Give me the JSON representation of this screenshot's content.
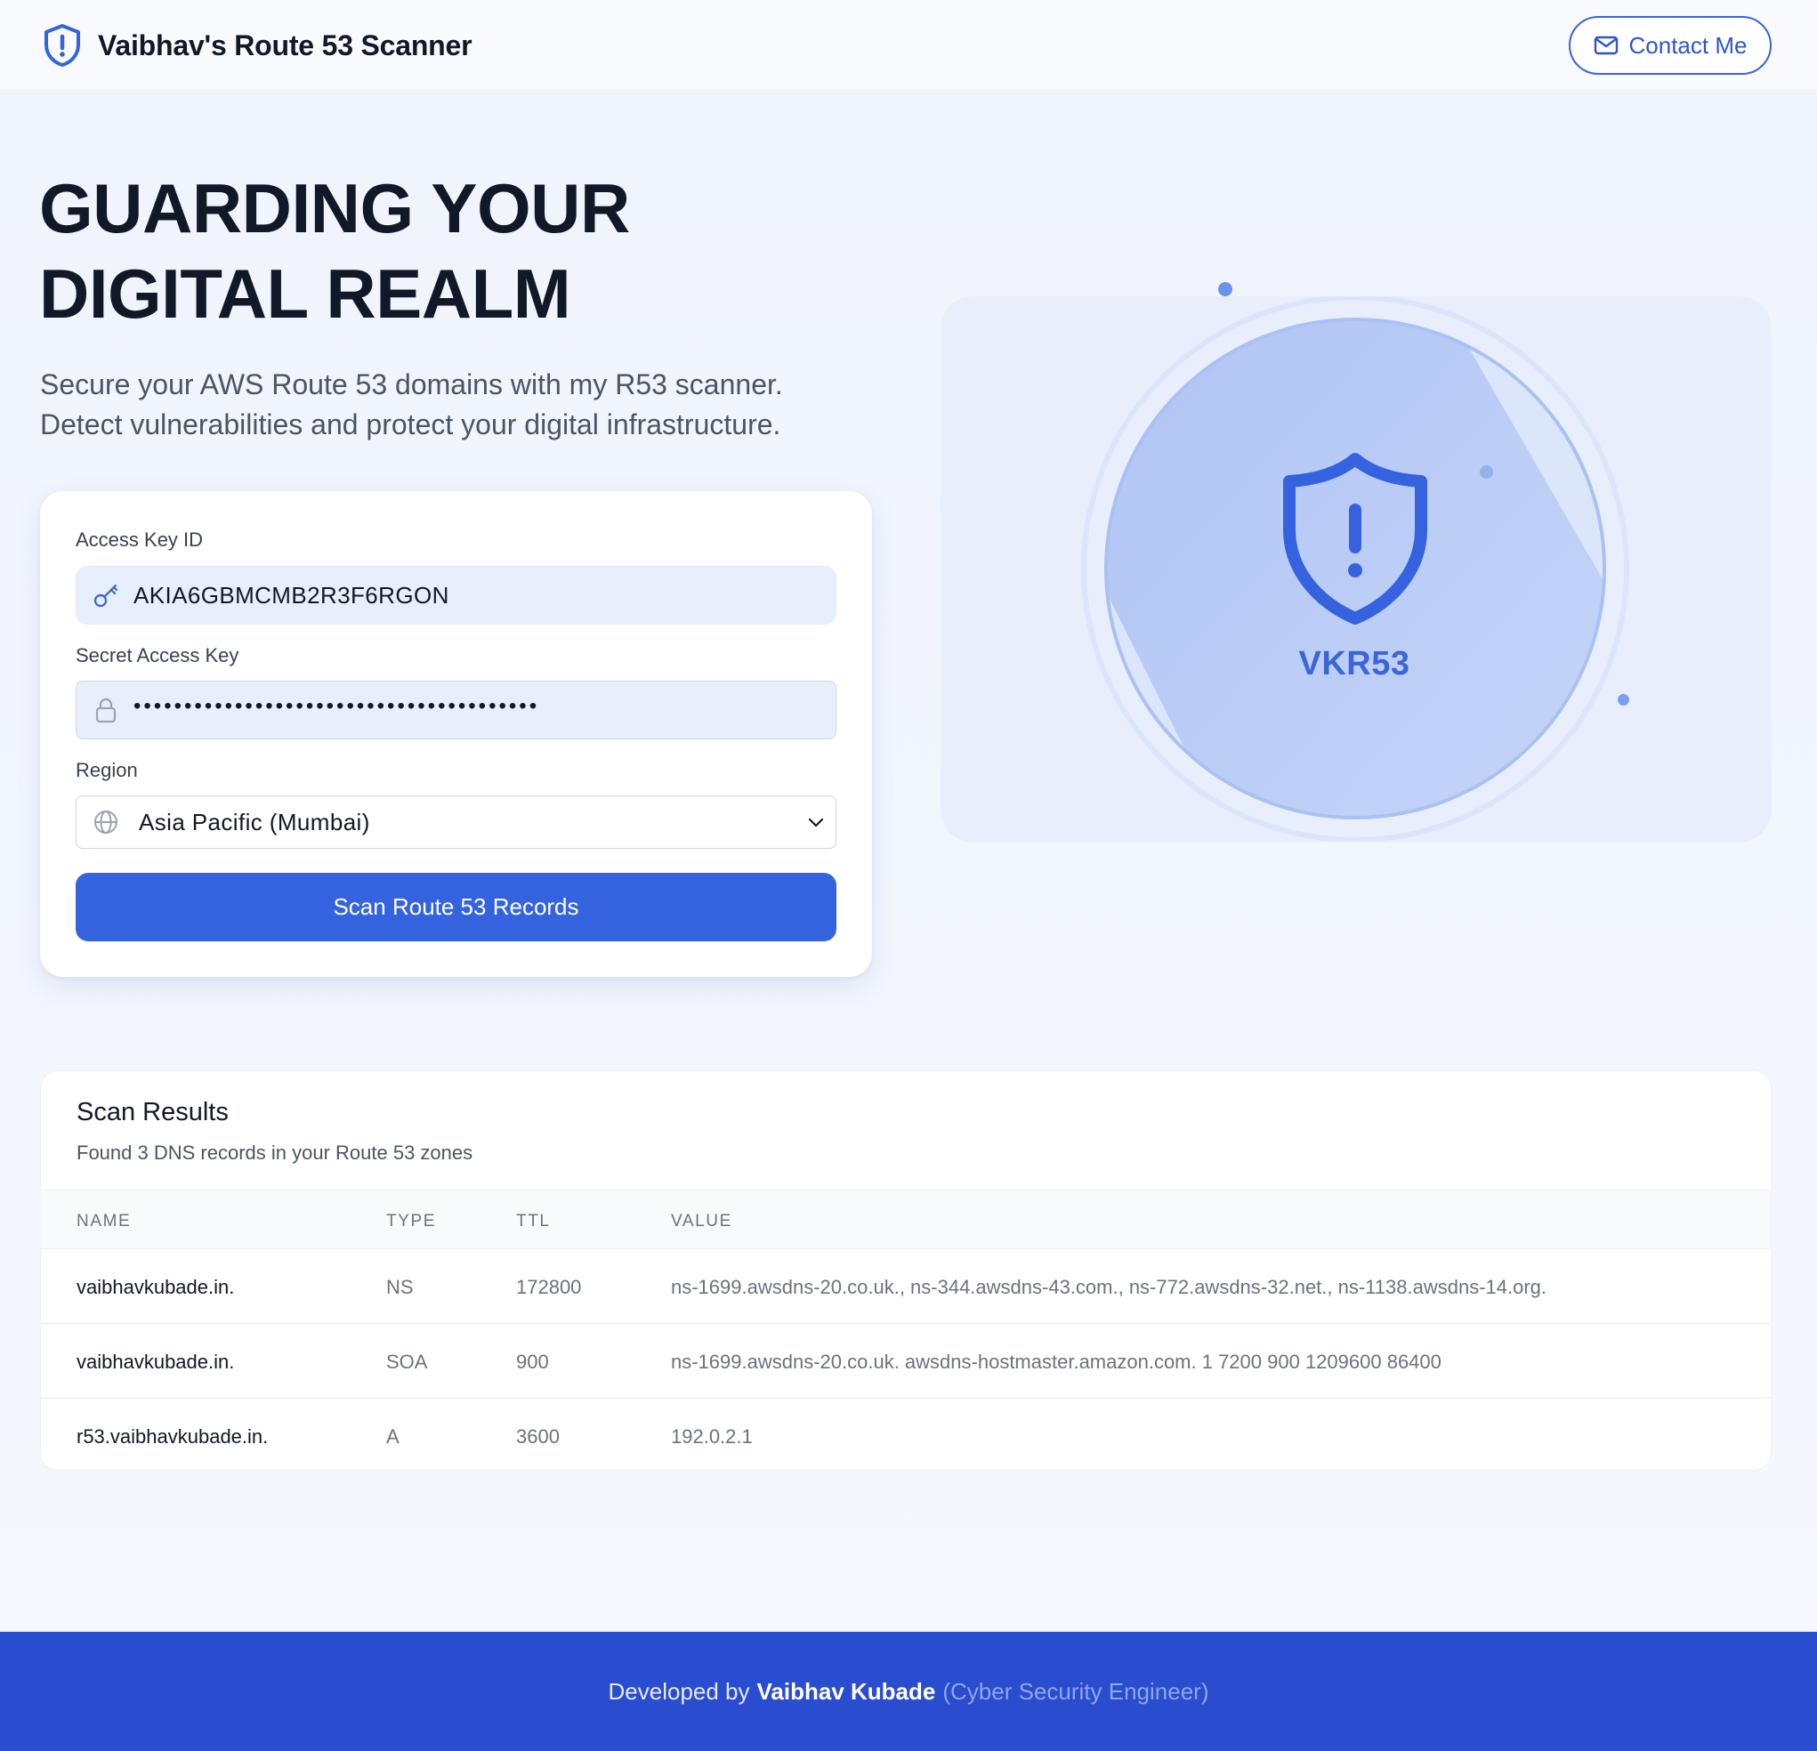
{
  "header": {
    "title": "Vaibhav's Route 53 Scanner",
    "contact_label": "Contact Me",
    "brand_icon": "shield-alert-icon",
    "contact_icon": "mail-icon"
  },
  "hero": {
    "title_line1": "GUARDING YOUR",
    "title_line2": "DIGITAL REALM",
    "subtitle_line1": "Secure your AWS Route 53 domains with my R53 scanner.",
    "subtitle_line2": "Detect vulnerabilities and protect your digital infrastructure."
  },
  "form": {
    "access_key_label": "Access Key ID",
    "access_key_value": "AKIA6GBMCMB2R3F6RGON",
    "secret_key_label": "Secret Access Key",
    "secret_key_value": "••••••••••••••••••••••••••••••••••••••••",
    "region_label": "Region",
    "region_value": "Asia Pacific (Mumbai)",
    "scan_button": "Scan Route 53 Records"
  },
  "illustration": {
    "label": "VKR53"
  },
  "results": {
    "title": "Scan Results",
    "summary": "Found 3 DNS records in your Route 53 zones",
    "columns": [
      "NAME",
      "TYPE",
      "TTL",
      "VALUE"
    ],
    "rows": [
      {
        "name": "vaibhavkubade.in.",
        "type": "NS",
        "ttl": "172800",
        "value": "ns-1699.awsdns-20.co.uk., ns-344.awsdns-43.com., ns-772.awsdns-32.net., ns-1138.awsdns-14.org."
      },
      {
        "name": "vaibhavkubade.in.",
        "type": "SOA",
        "ttl": "900",
        "value": "ns-1699.awsdns-20.co.uk. awsdns-hostmaster.amazon.com. 1 7200 900 1209600 86400"
      },
      {
        "name": "r53.vaibhavkubade.in.",
        "type": "A",
        "ttl": "3600",
        "value": "192.0.2.1"
      }
    ]
  },
  "footer": {
    "prefix": "Developed by",
    "author": "Vaibhav Kubade",
    "role": "(Cyber Security Engineer)"
  },
  "colors": {
    "accent": "#3563e0",
    "footer_bg": "#2a4ccf",
    "page_bg": "#f0f4fd"
  }
}
